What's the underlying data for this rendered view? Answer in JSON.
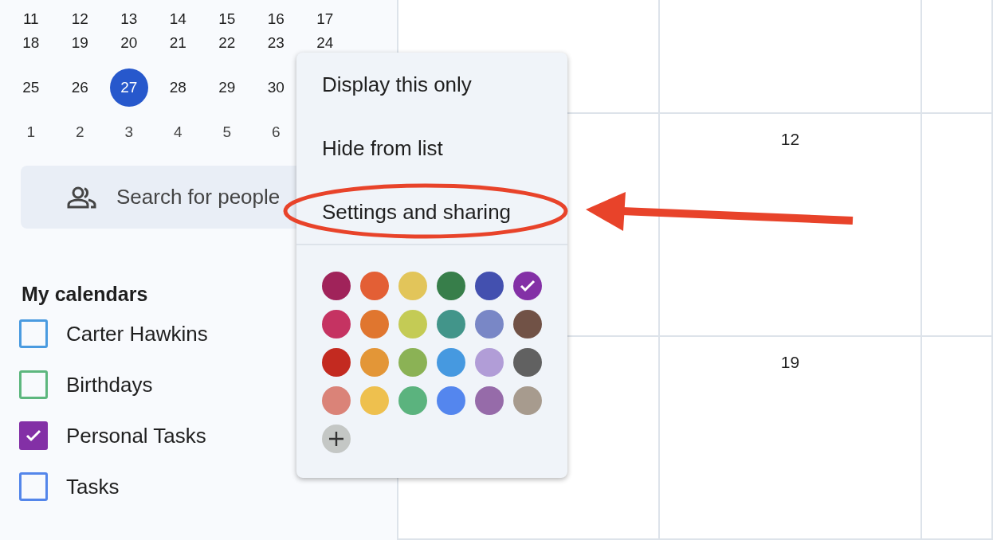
{
  "mini_calendar": {
    "weeks": [
      {
        "days": [
          {
            "label": "11",
            "selected": false,
            "other_month": false
          },
          {
            "label": "12",
            "selected": false,
            "other_month": false
          },
          {
            "label": "13",
            "selected": false,
            "other_month": false
          },
          {
            "label": "14",
            "selected": false,
            "other_month": false
          },
          {
            "label": "15",
            "selected": false,
            "other_month": false
          },
          {
            "label": "16",
            "selected": false,
            "other_month": false
          },
          {
            "label": "17",
            "selected": false,
            "other_month": false
          }
        ]
      },
      {
        "days": [
          {
            "label": "18",
            "selected": false,
            "other_month": false
          },
          {
            "label": "19",
            "selected": false,
            "other_month": false
          },
          {
            "label": "20",
            "selected": false,
            "other_month": false
          },
          {
            "label": "21",
            "selected": false,
            "other_month": false
          },
          {
            "label": "22",
            "selected": false,
            "other_month": false
          },
          {
            "label": "23",
            "selected": false,
            "other_month": false
          },
          {
            "label": "24",
            "selected": false,
            "other_month": false
          }
        ]
      },
      {
        "days": [
          {
            "label": "25",
            "selected": false,
            "other_month": false
          },
          {
            "label": "26",
            "selected": false,
            "other_month": false
          },
          {
            "label": "27",
            "selected": true,
            "other_month": false
          },
          {
            "label": "28",
            "selected": false,
            "other_month": false
          },
          {
            "label": "29",
            "selected": false,
            "other_month": false
          },
          {
            "label": "30",
            "selected": false,
            "other_month": false
          }
        ]
      },
      {
        "days": [
          {
            "label": "1",
            "selected": false,
            "other_month": true
          },
          {
            "label": "2",
            "selected": false,
            "other_month": true
          },
          {
            "label": "3",
            "selected": false,
            "other_month": true
          },
          {
            "label": "4",
            "selected": false,
            "other_month": true
          },
          {
            "label": "5",
            "selected": false,
            "other_month": true
          },
          {
            "label": "6",
            "selected": false,
            "other_month": true
          }
        ]
      }
    ]
  },
  "people_search": {
    "placeholder": "Search for people"
  },
  "my_calendars": {
    "title": "My calendars",
    "items": [
      {
        "label": "Carter Hawkins",
        "checked": false,
        "color": "#4a9be0"
      },
      {
        "label": "Birthdays",
        "checked": false,
        "color": "#5db77e"
      },
      {
        "label": "Personal Tasks",
        "checked": true,
        "color": "#8330a6"
      },
      {
        "label": "Tasks",
        "checked": false,
        "color": "#5486ea"
      }
    ]
  },
  "month_view": {
    "dates": [
      "12",
      "19"
    ]
  },
  "context_menu": {
    "items": [
      {
        "label": "Display this only",
        "highlighted": false
      },
      {
        "label": "Hide from list",
        "highlighted": false
      },
      {
        "label": "Settings and sharing",
        "highlighted": true
      }
    ],
    "swatches": [
      {
        "color": "#a0235a",
        "selected": false
      },
      {
        "color": "#e35f35",
        "selected": false
      },
      {
        "color": "#e2c55a",
        "selected": false
      },
      {
        "color": "#377e4a",
        "selected": false
      },
      {
        "color": "#4350af",
        "selected": false
      },
      {
        "color": "#8330a6",
        "selected": true
      },
      {
        "color": "#c53362",
        "selected": false
      },
      {
        "color": "#e0762f",
        "selected": false
      },
      {
        "color": "#c4cb55",
        "selected": false
      },
      {
        "color": "#42958a",
        "selected": false
      },
      {
        "color": "#7987c6",
        "selected": false
      },
      {
        "color": "#715246",
        "selected": false
      },
      {
        "color": "#c32a20",
        "selected": false
      },
      {
        "color": "#e39637",
        "selected": false
      },
      {
        "color": "#8bb255",
        "selected": false
      },
      {
        "color": "#4699e0",
        "selected": false
      },
      {
        "color": "#b19dd7",
        "selected": false
      },
      {
        "color": "#616161",
        "selected": false
      },
      {
        "color": "#da8378",
        "selected": false
      },
      {
        "color": "#eec04e",
        "selected": false
      },
      {
        "color": "#5bb37e",
        "selected": false
      },
      {
        "color": "#5486ee",
        "selected": false
      },
      {
        "color": "#966ba9",
        "selected": false
      },
      {
        "color": "#a79b8e",
        "selected": false
      }
    ]
  },
  "annotation": {
    "arrow": true
  }
}
